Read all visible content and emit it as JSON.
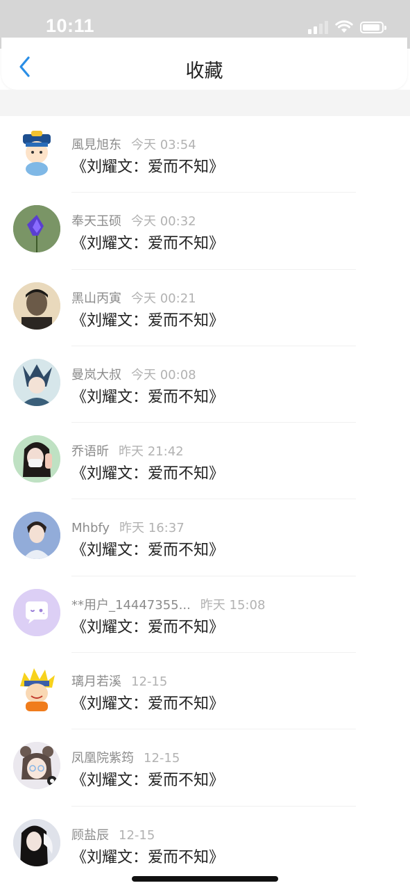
{
  "status_bar": {
    "time": "10:11"
  },
  "header": {
    "title": "收藏"
  },
  "colors": {
    "accent": "#2a8ee6",
    "divider": "#f0f0f0"
  },
  "favorites": [
    {
      "name": "風見旭东",
      "time": "今天 03:54",
      "title": "《刘耀文：爱而不知》",
      "avatar": "cartoon-qing-official"
    },
    {
      "name": "奉天玉硕",
      "time": "今天 00:32",
      "title": "《刘耀文：爱而不知》",
      "avatar": "purple-flower"
    },
    {
      "name": "黑山丙寅",
      "time": "今天 00:21",
      "title": "《刘耀文：爱而不知》",
      "avatar": "man-portrait"
    },
    {
      "name": "曼岚大叔",
      "time": "今天 00:08",
      "title": "《刘耀文：爱而不知》",
      "avatar": "anime-character"
    },
    {
      "name": "乔语昕",
      "time": "昨天 21:42",
      "title": "《刘耀文：爱而不知》",
      "avatar": "girl-mask"
    },
    {
      "name": "Mhbfy",
      "time": "昨天 16:37",
      "title": "《刘耀文：爱而不知》",
      "avatar": "boy-blue-bg"
    },
    {
      "name": "**用户_14447355...",
      "time": "昨天 15:08",
      "title": "《刘耀文：爱而不知》",
      "avatar": "default-chat-bubble"
    },
    {
      "name": "璃月若溪",
      "time": "12-15",
      "title": "《刘耀文：爱而不知》",
      "avatar": "naruto-cartoon"
    },
    {
      "name": "凤凰院紫筠",
      "time": "12-15",
      "title": "《刘耀文：爱而不知》",
      "avatar": "girl-bear-ears"
    },
    {
      "name": "顾盐辰",
      "time": "12-15",
      "title": "《刘耀文：爱而不知》",
      "avatar": "girl-dark-hair"
    }
  ]
}
